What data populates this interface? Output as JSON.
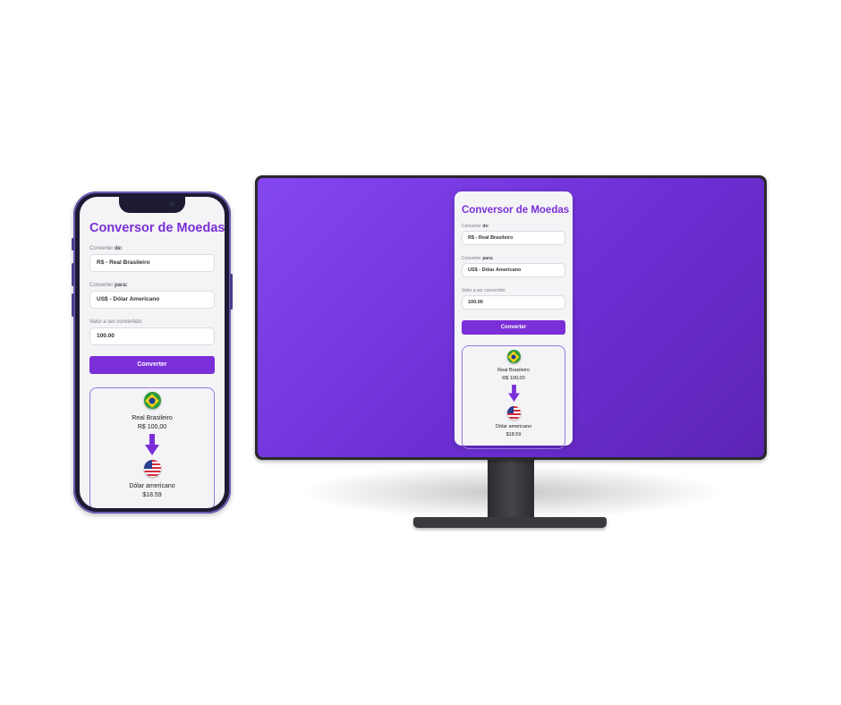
{
  "app": {
    "title": "Conversor de Moedas",
    "from_label_prefix": "Converter ",
    "from_label_bold": "de:",
    "from_value": "R$ - Real Brasileiro",
    "to_label_prefix": "Converter ",
    "to_label_bold": "para:",
    "to_value": "US$ - Dólar Americano",
    "amount_label": "Valor a ser convertido:",
    "amount_value": "100.00",
    "convert_button": "Converter",
    "result": {
      "from_currency_name": "Real Brasileiro",
      "from_amount": "R$ 100,00",
      "to_currency_name": "Dólar americano",
      "to_amount": "$18.59",
      "from_flag_icon": "brazil-flag-icon",
      "to_flag_icon": "usa-flag-icon",
      "arrow_icon": "arrow-down-icon"
    }
  },
  "colors": {
    "accent": "#7a2fd8",
    "screen_gradient_start": "#8447f0",
    "screen_gradient_end": "#5c24b5"
  }
}
